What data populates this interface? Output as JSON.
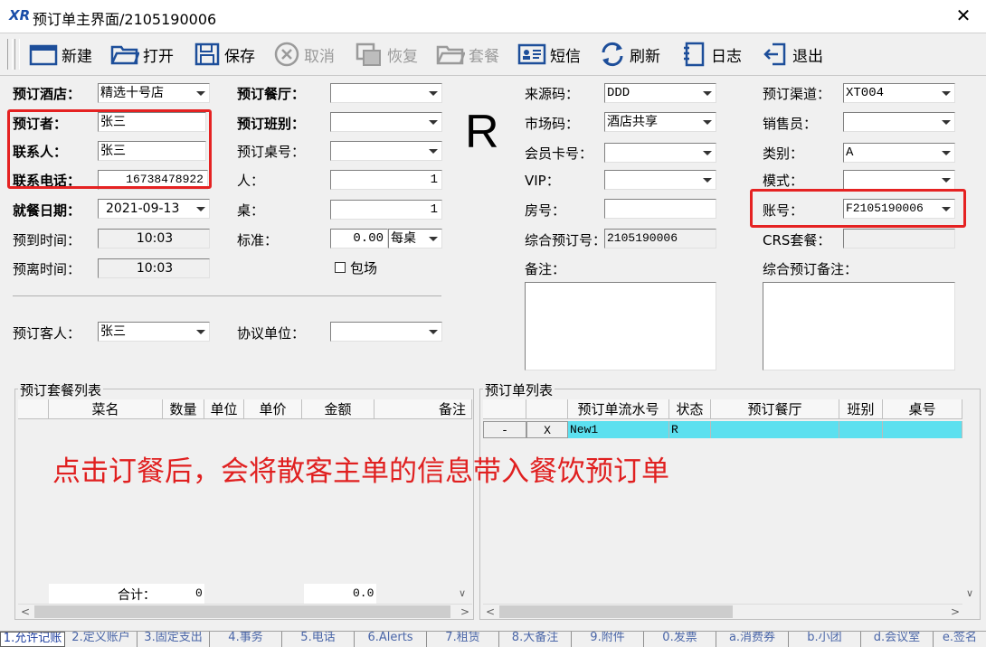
{
  "window": {
    "title": "预订单主界面/2105190006",
    "logo": "XR",
    "close": "✕"
  },
  "toolbar": {
    "new": "新建",
    "open": "打开",
    "save": "保存",
    "cancel": "取消",
    "restore": "恢复",
    "package": "套餐",
    "sms": "短信",
    "refresh": "刷新",
    "log": "日志",
    "exit": "退出"
  },
  "form": {
    "hotel_label": "预订酒店：",
    "hotel_value": "精选十号店",
    "booker_label": "预订者：",
    "booker_value": "张三",
    "contact_label": "联系人：",
    "contact_value": "张三",
    "phone_label": "联系电话：",
    "phone_value": "16738478922",
    "date_label": "就餐日期：",
    "date_value": "2021-09-13",
    "arrive_label": "预到时间：",
    "arrive_value": "10:03",
    "leave_label": "预离时间：",
    "leave_value": "10:03",
    "guest_label": "预订客人：",
    "guest_value": "张三",
    "hall_label": "预订餐厅：",
    "hall_value": "",
    "shift_label": "预订班别：",
    "shift_value": "",
    "tableno_label": "预订桌号：",
    "tableno_value": "",
    "people_label": "人：",
    "people_value": "1",
    "tables_label": "桌：",
    "tables_value": "1",
    "std_label": "标准：",
    "std_value": "0.00",
    "std_unit": "每桌",
    "room_pkg_label": "包场",
    "agreement_label": "协议单位：",
    "agreement_value": "",
    "status_letter": "R",
    "source_label": "来源码：",
    "source_value": "DDD",
    "market_label": "市场码：",
    "market_value": "酒店共享",
    "member_label": "会员卡号：",
    "member_value": "",
    "vip_label": "VIP：",
    "vip_value": "",
    "roomno_label": "房号：",
    "roomno_value": "",
    "combined_label": "综合预订号：",
    "combined_value": "2105190006",
    "remark_label": "备注：",
    "channel_label": "预订渠道：",
    "channel_value": "XT004",
    "sales_label": "销售员：",
    "sales_value": "",
    "category_label": "类别：",
    "category_value": "A",
    "mode_label": "模式：",
    "mode_value": "",
    "account_label": "账号：",
    "account_value": "F2105190006",
    "crs_label": "CRS套餐：",
    "crs_value": "",
    "combined_remark_label": "综合预订备注："
  },
  "package_list": {
    "title": "预订套餐列表",
    "columns": [
      "菜名",
      "数量",
      "单位",
      "单价",
      "金额",
      "备注"
    ],
    "total_label": "合计：",
    "total_qty": "0",
    "total_amount": "0.0"
  },
  "order_list": {
    "title": "预订单列表",
    "columns": [
      "预订单流水号",
      "状态",
      "预订餐厅",
      "班别",
      "桌号"
    ],
    "rows": [
      {
        "minus": "-",
        "x": "X",
        "serial": "New1",
        "status": "R",
        "hall": "",
        "shift": "",
        "table": ""
      }
    ]
  },
  "annotation": "点击订餐后，会将散客主单的信息带入餐饮预订单",
  "tabs": [
    "1.允许记账",
    "2.定义账户",
    "3.固定支出",
    "4.事务",
    "5.电话",
    "6.Alerts",
    "7.租赁",
    "8.大备注",
    "9.附件",
    "0.发票",
    "a.消费券",
    "b.小团",
    "d.会议室",
    "e.签名"
  ],
  "colors": {
    "accent_red": "#e52222",
    "row_highlight": "#5ce0ef",
    "tab_text": "#4a66a8"
  }
}
